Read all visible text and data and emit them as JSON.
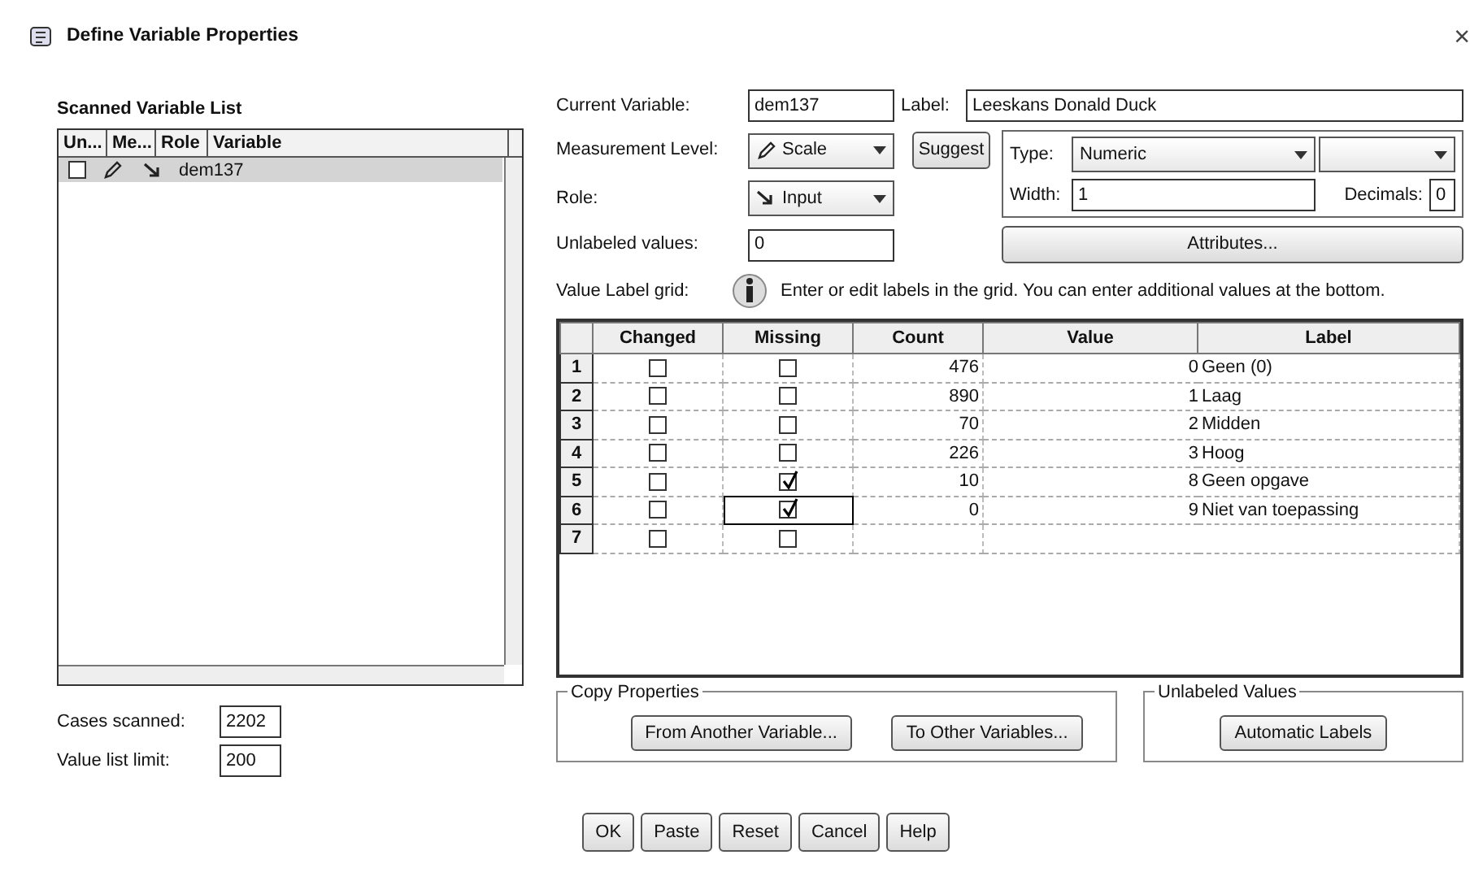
{
  "window": {
    "title": "Define Variable Properties",
    "close": "×"
  },
  "scanned_list": {
    "title": "Scanned Variable List",
    "columns": [
      "Un...",
      "Me...",
      "Role",
      "Variable"
    ],
    "rows": [
      {
        "variable": "dem137",
        "unlabeled": false,
        "selected": true
      }
    ]
  },
  "cases_scanned": {
    "label": "Cases scanned:",
    "value": "2202"
  },
  "value_list_limit": {
    "label": "Value list limit:",
    "value": "200"
  },
  "current_variable": {
    "label": "Current Variable:",
    "value": "dem137"
  },
  "variable_label": {
    "label": "Label:",
    "value": "Leeskans Donald Duck"
  },
  "measurement_level": {
    "label": "Measurement Level:",
    "value": "Scale"
  },
  "suggest_button": "Suggest",
  "type": {
    "label": "Type:",
    "value": "Numeric"
  },
  "role": {
    "label": "Role:",
    "value": "Input"
  },
  "width": {
    "label": "Width:",
    "value": "1"
  },
  "decimals": {
    "label": "Decimals:",
    "value": "0"
  },
  "unlabeled_values": {
    "label": "Unlabeled values:",
    "value": "0"
  },
  "attributes_button": "Attributes...",
  "grid_hint": {
    "label": "Value Label grid:",
    "text": "Enter or edit labels in the grid. You can enter additional values at the bottom."
  },
  "grid": {
    "columns": [
      "Changed",
      "Missing",
      "Count",
      "Value",
      "Label"
    ],
    "rows": [
      {
        "number": "1",
        "changed": false,
        "missing": false,
        "focused": false,
        "count": "476",
        "code": "0",
        "code_label": "Geen (0)"
      },
      {
        "number": "2",
        "changed": false,
        "missing": false,
        "focused": false,
        "count": "890",
        "code": "1",
        "code_label": "Laag"
      },
      {
        "number": "3",
        "changed": false,
        "missing": false,
        "focused": false,
        "count": "70",
        "code": "2",
        "code_label": "Midden"
      },
      {
        "number": "4",
        "changed": false,
        "missing": false,
        "focused": false,
        "count": "226",
        "code": "3",
        "code_label": "Hoog"
      },
      {
        "number": "5",
        "changed": false,
        "missing": true,
        "focused": false,
        "count": "10",
        "code": "8",
        "code_label": "Geen opgave"
      },
      {
        "number": "6",
        "changed": false,
        "missing": true,
        "focused": true,
        "count": "0",
        "code": "9",
        "code_label": "Niet van toepassing"
      },
      {
        "number": "7",
        "changed": false,
        "missing": false,
        "focused": false
      }
    ]
  },
  "copy_properties": {
    "title": "Copy Properties",
    "buttons": [
      "From Another Variable...",
      "To Other Variables..."
    ]
  },
  "unlabeled_values_group": {
    "title": "Unlabeled Values",
    "buttons": [
      "Automatic Labels"
    ]
  },
  "footer_buttons": [
    "OK",
    "Paste",
    "Reset",
    "Cancel",
    "Help"
  ]
}
